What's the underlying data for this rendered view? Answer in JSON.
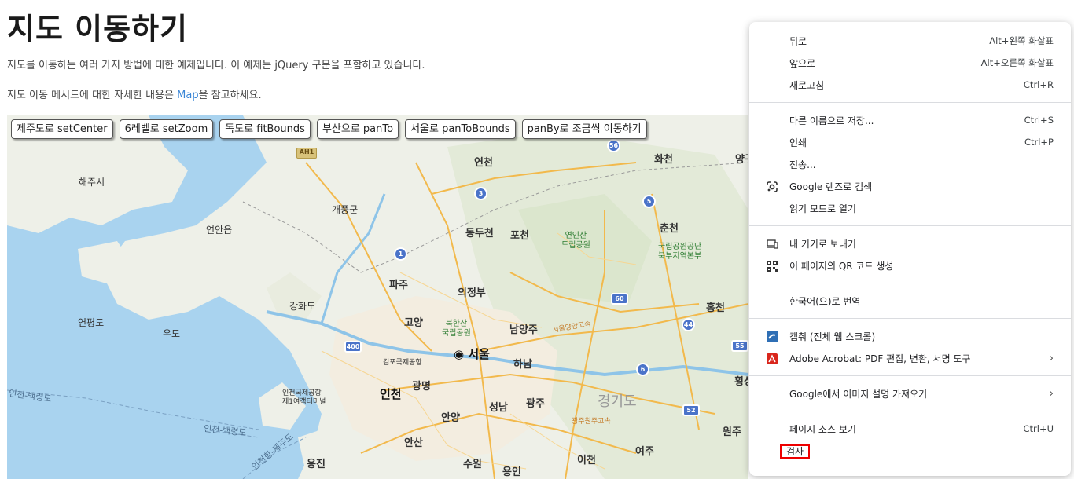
{
  "page": {
    "title": "지도 이동하기",
    "intro": "지도를 이동하는 여러 가지 방법에 대한 예제입니다. 이 예제는 jQuery 구문을 포함하고 있습니다.",
    "ref_prefix": "지도 이동 메서드에 대한 자세한 내용은 ",
    "ref_link": "Map",
    "ref_suffix": "을 참고하세요."
  },
  "map_buttons": [
    "제주도로 setCenter",
    "6레벨로 setZoom",
    "독도로 fitBounds",
    "부산으로 panTo",
    "서울로 panToBounds",
    "panBy로 조금씩 이동하기"
  ],
  "map_labels": {
    "haeju": "해주시",
    "gaepung": "개풍군",
    "ganghwa": "강화도",
    "yeonan": "연안읍",
    "yeonpyeong": "연평도",
    "udo": "우도",
    "yeoncheon": "연천",
    "hwacheon": "화천",
    "yang": "양구",
    "dongducheon": "동두천",
    "pocheon": "포천",
    "chuncheon": "춘천",
    "paju": "파주",
    "uijeongbu": "의정부",
    "goyang": "고양",
    "namyangju": "남양주",
    "hongcheon": "홍천",
    "seoul": "서울",
    "hanam": "하남",
    "gimpo": "김포국제공항",
    "incheon": "인천",
    "gwangmyeong": "광명",
    "anyang": "안양",
    "seongnam": "성남",
    "gwangju": "광주",
    "gyeonggi": "경기도",
    "ansan": "안산",
    "suwon": "수원",
    "yongin": "용인",
    "icheon": "이천",
    "yeoju": "여주",
    "wonju": "원주",
    "ongjin": "옹진",
    "airport": "인천국제공항\n제1여객터미널",
    "park1": "연인산\n도립공원",
    "park2": "국립공원공단\n북부지역본부",
    "park3": "북한산\n국립공원",
    "hoengseong": "횡성",
    "route1": "인천-백령도",
    "route2": "인천-백령도",
    "route3": "인천항-제주도",
    "road1": "서울양양고속",
    "road2": "광주원주고속",
    "ah1": "AH1"
  },
  "map_shields": [
    "56",
    "3",
    "5",
    "1",
    "60",
    "44",
    "400",
    "6",
    "55",
    "52"
  ],
  "context_menu": {
    "groups": [
      [
        {
          "label": "뒤로",
          "shortcut": "Alt+왼쪽 화살표"
        },
        {
          "label": "앞으로",
          "shortcut": "Alt+오른쪽 화살표"
        },
        {
          "label": "새로고침",
          "shortcut": "Ctrl+R"
        }
      ],
      [
        {
          "label": "다른 이름으로 저장...",
          "shortcut": "Ctrl+S"
        },
        {
          "label": "인쇄",
          "shortcut": "Ctrl+P"
        },
        {
          "label": "전송..."
        },
        {
          "label": "Google 렌즈로 검색",
          "icon": "google-lens-icon"
        },
        {
          "label": "읽기 모드로 열기"
        }
      ],
      [
        {
          "label": "내 기기로 보내기",
          "icon": "send-to-device-icon"
        },
        {
          "label": "이 페이지의 QR 코드 생성",
          "icon": "qr-code-icon"
        }
      ],
      [
        {
          "label": "한국어(으)로 번역"
        }
      ],
      [
        {
          "label": "캡춰 (전체 웹 스크롤)",
          "icon": "capture-extension-icon"
        },
        {
          "label": "Adobe Acrobat: PDF 편집, 변환, 서명 도구",
          "icon": "adobe-acrobat-icon",
          "submenu": true
        }
      ],
      [
        {
          "label": "Google에서 이미지 설명 가져오기",
          "submenu": true
        }
      ],
      [
        {
          "label": "페이지 소스 보기",
          "shortcut": "Ctrl+U"
        },
        {
          "label": "검사",
          "highlighted": true
        }
      ]
    ]
  }
}
